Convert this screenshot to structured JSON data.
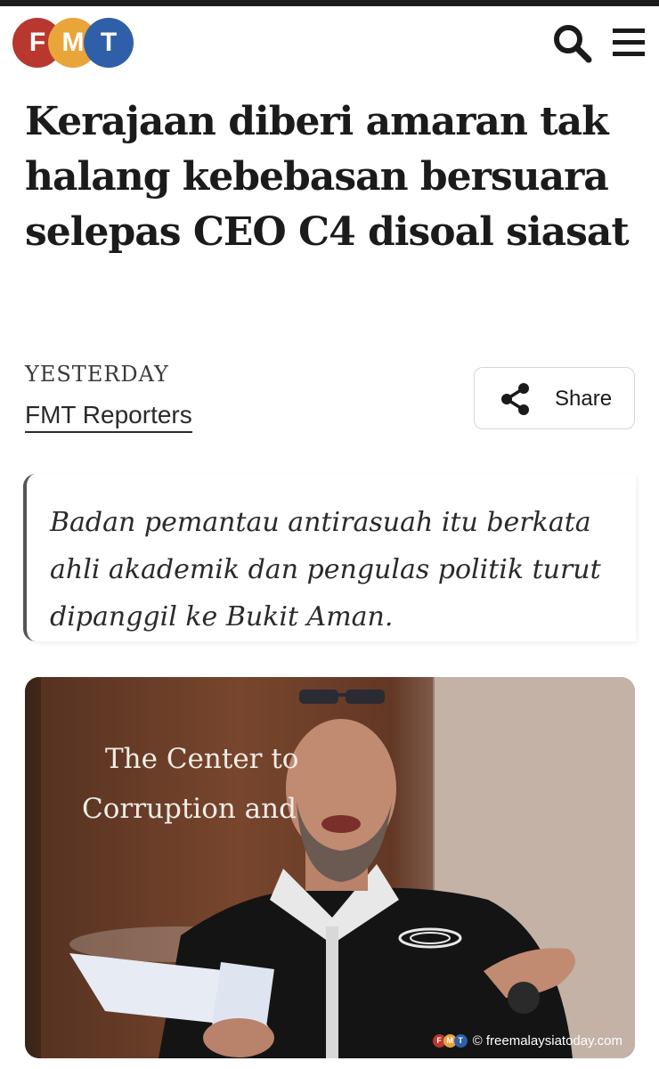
{
  "header": {
    "logo": {
      "letters": [
        "F",
        "M",
        "T"
      ],
      "colors": [
        "#b8372f",
        "#e9a53a",
        "#2f5fa8"
      ]
    },
    "search_icon": "search-icon",
    "menu_icon": "hamburger-menu-icon"
  },
  "article": {
    "headline": "Kerajaan diberi amaran tak halang kebebasan bersuara selepas CEO C4 disoal siasat",
    "date": "YESTERDAY",
    "author": "FMT Reporters",
    "share_label": "Share",
    "excerpt": "Badan pemantau antirasuah itu berkata ahli akademik dan pengulas politik turut dipanggil ke Bukit Aman."
  },
  "photo": {
    "banner_line_1": "The Center to",
    "banner_line_2": "Corruption and",
    "credit_logo": [
      "F",
      "M",
      "T"
    ],
    "credit": "© freemalaysiatoday.com"
  }
}
